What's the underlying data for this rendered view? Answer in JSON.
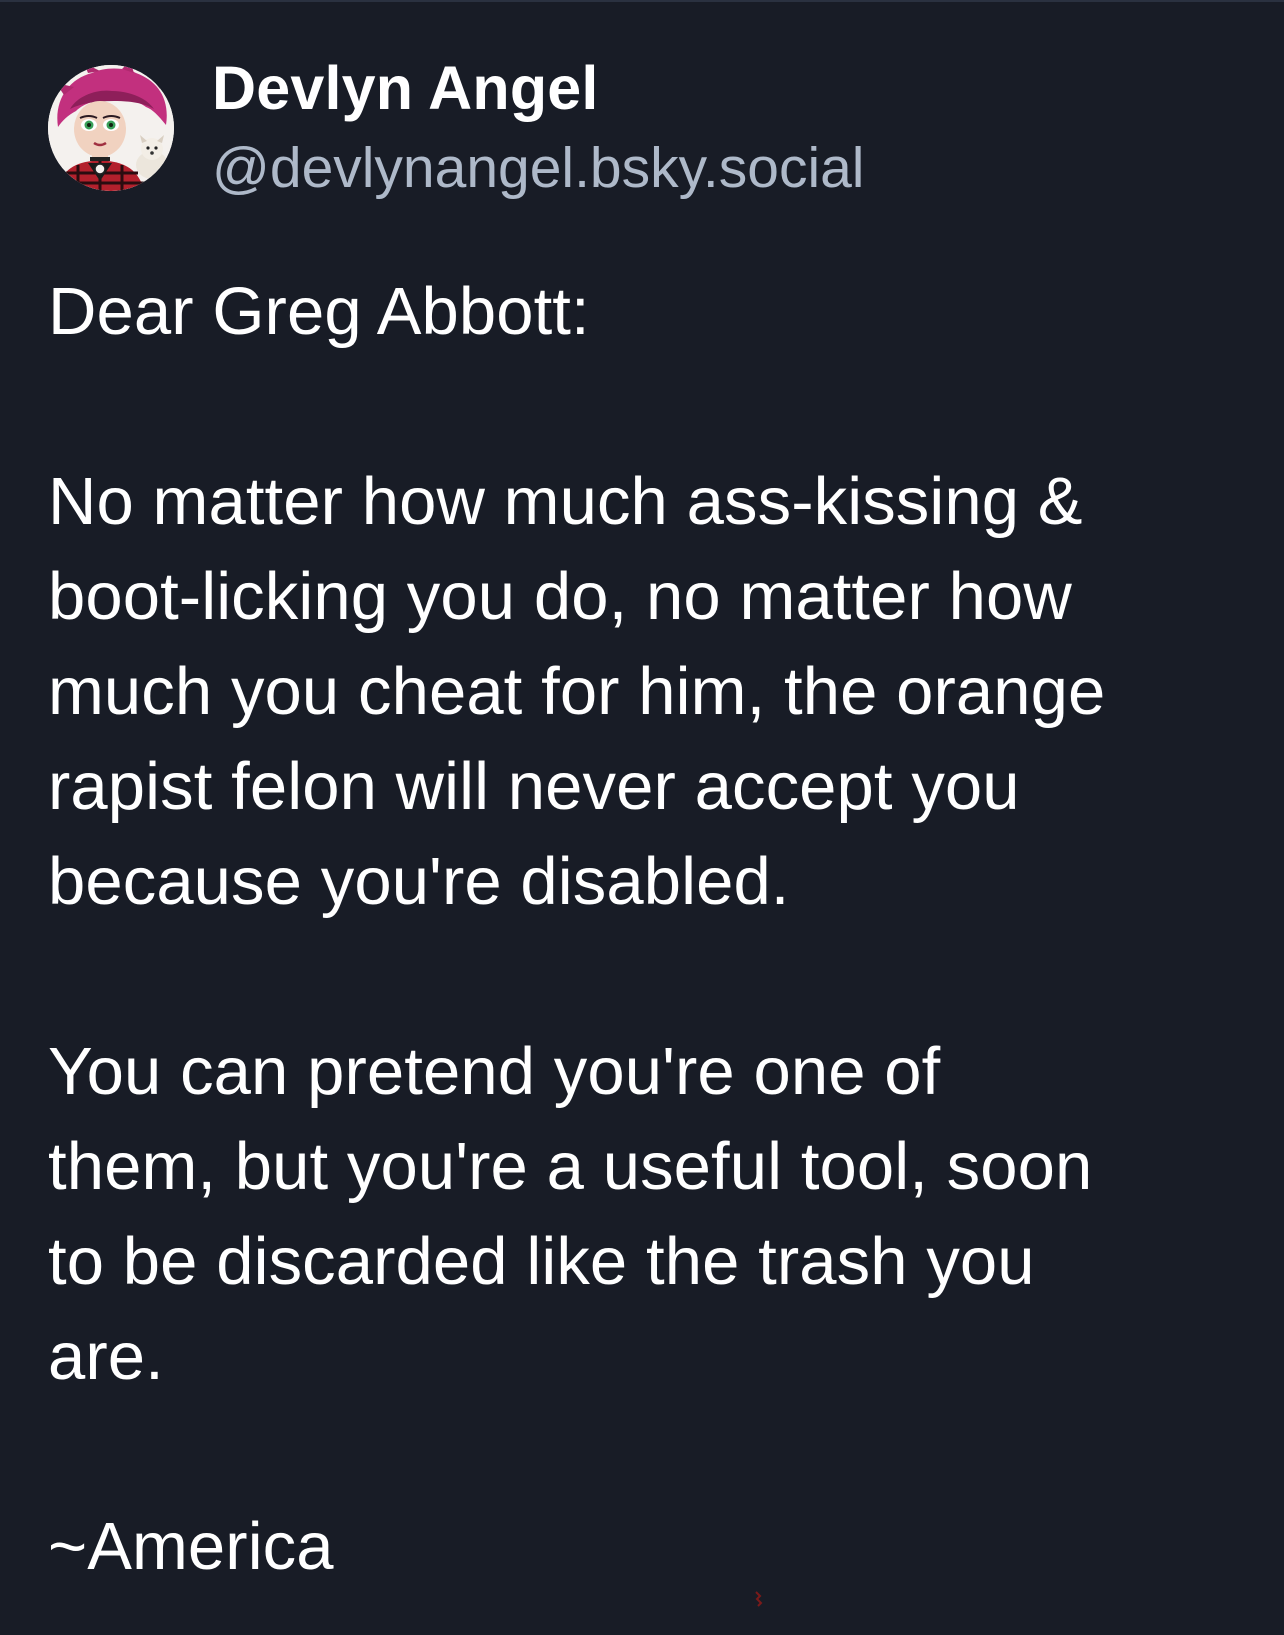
{
  "post": {
    "author": {
      "display_name": "Devlyn Angel",
      "handle": "@devlynangel.bsky.social",
      "avatar_icon": "cartoon-avatar-pink-hair"
    },
    "paragraphs": [
      "Dear Greg Abbott:",
      "No matter how much ass-kissing &\nboot-licking you do, no matter how\nmuch you cheat for him, the orange\nrapist felon will never accept you\nbecause you're disabled.",
      "You can pretend you're one of\nthem, but you're a useful tool, soon\nto be discarded like the trash you\nare.",
      "~America"
    ]
  },
  "colors": {
    "background": "#181c26",
    "text": "#ffffff",
    "handle": "#aeb9c9"
  }
}
